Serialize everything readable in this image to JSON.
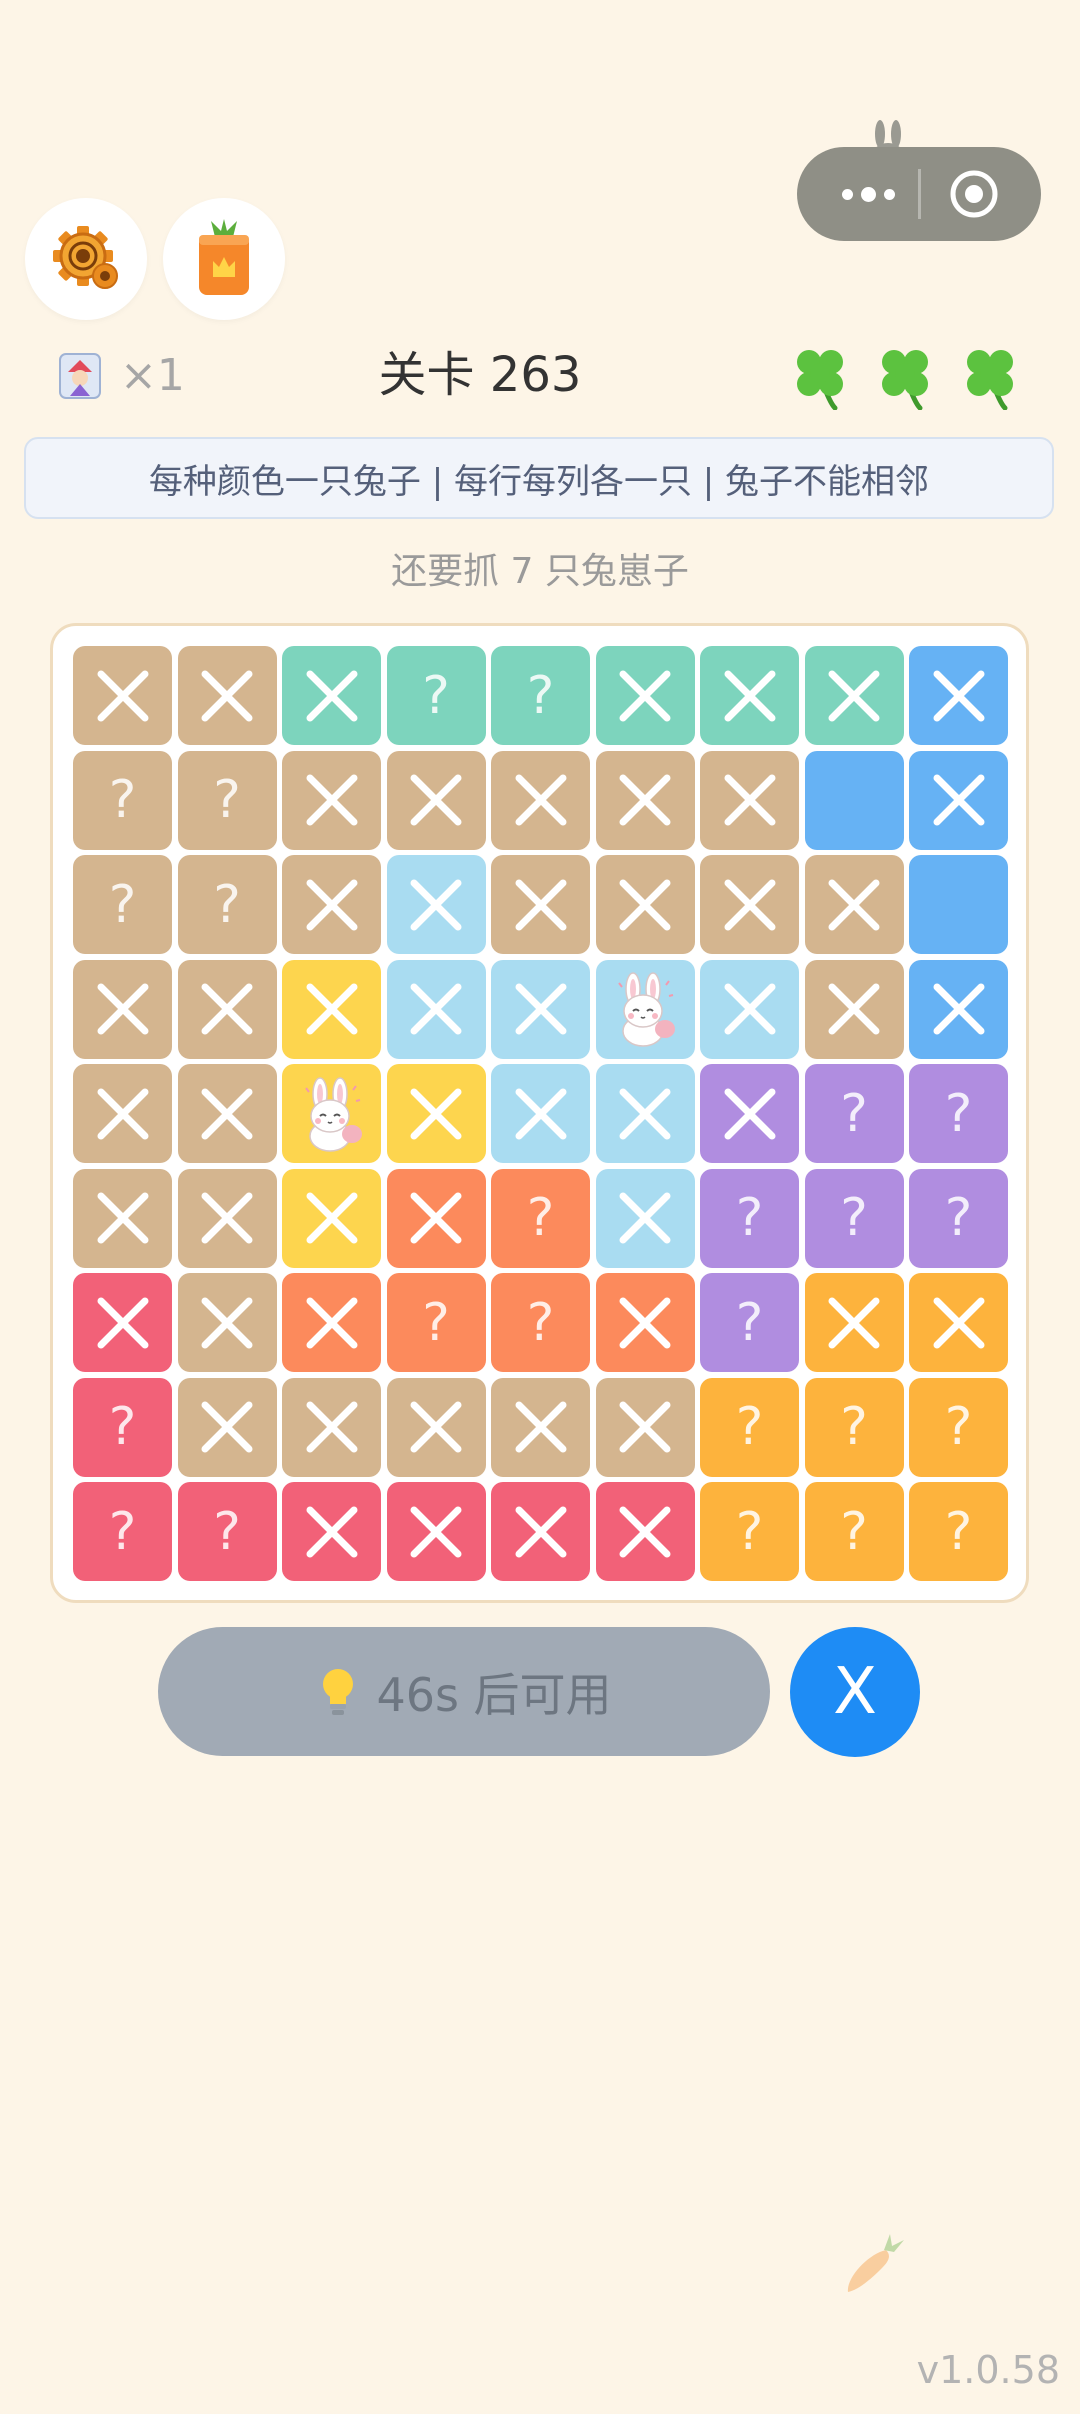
{
  "header": {
    "joker_count": "×1",
    "level_title": "关卡 263",
    "clover_count": 3
  },
  "rules_text": "每种颜色一只兔子 | 每行每列各一只 | 兔子不能相邻",
  "remaining_text": "还要抓 7 只兔崽子",
  "colors": {
    "background": "#fdf5e7",
    "T": "#d4b58f",
    "G": "#7dd4bd",
    "B": "#66b2f4",
    "L": "#a9dcf1",
    "Y": "#fdd54e",
    "P": "#b08de0",
    "O": "#fc8a5c",
    "R": "#f26178",
    "A": "#fdb33d",
    "hint_button": "#a1aab5",
    "x_button": "#1e8cf5",
    "clover": "#5cc23f"
  },
  "board": {
    "rows": 9,
    "cols": 9,
    "colors": [
      [
        "T",
        "T",
        "G",
        "G",
        "G",
        "G",
        "G",
        "G",
        "B"
      ],
      [
        "T",
        "T",
        "T",
        "T",
        "T",
        "T",
        "T",
        "B",
        "B"
      ],
      [
        "T",
        "T",
        "T",
        "L",
        "T",
        "T",
        "T",
        "T",
        "B"
      ],
      [
        "T",
        "T",
        "Y",
        "L",
        "L",
        "L",
        "L",
        "T",
        "B"
      ],
      [
        "T",
        "T",
        "Y",
        "Y",
        "L",
        "L",
        "P",
        "P",
        "P"
      ],
      [
        "T",
        "T",
        "Y",
        "O",
        "O",
        "L",
        "P",
        "P",
        "P"
      ],
      [
        "R",
        "T",
        "O",
        "O",
        "O",
        "O",
        "P",
        "A",
        "A"
      ],
      [
        "R",
        "T",
        "T",
        "T",
        "T",
        "T",
        "A",
        "A",
        "A"
      ],
      [
        "R",
        "R",
        "R",
        "R",
        "R",
        "R",
        "A",
        "A",
        "A"
      ]
    ],
    "states": [
      [
        "x",
        "x",
        "x",
        "?",
        "?",
        "x",
        "x",
        "x",
        "x"
      ],
      [
        "?",
        "?",
        "x",
        "x",
        "x",
        "x",
        "x",
        "",
        "x"
      ],
      [
        "?",
        "?",
        "x",
        "x",
        "x",
        "x",
        "x",
        "x",
        ""
      ],
      [
        "x",
        "x",
        "x",
        "x",
        "x",
        "b",
        "x",
        "x",
        "x"
      ],
      [
        "x",
        "x",
        "b",
        "x",
        "x",
        "x",
        "x",
        "?",
        "?"
      ],
      [
        "x",
        "x",
        "x",
        "x",
        "?",
        "x",
        "?",
        "?",
        "?"
      ],
      [
        "x",
        "x",
        "x",
        "?",
        "?",
        "x",
        "?",
        "x",
        "x"
      ],
      [
        "?",
        "x",
        "x",
        "x",
        "x",
        "x",
        "?",
        "?",
        "?"
      ],
      [
        "?",
        "?",
        "x",
        "x",
        "x",
        "x",
        "?",
        "?",
        "?"
      ]
    ]
  },
  "hint_button": {
    "label": "46s 后可用"
  },
  "x_button": {
    "label": "X"
  },
  "version": "v1.0.58"
}
